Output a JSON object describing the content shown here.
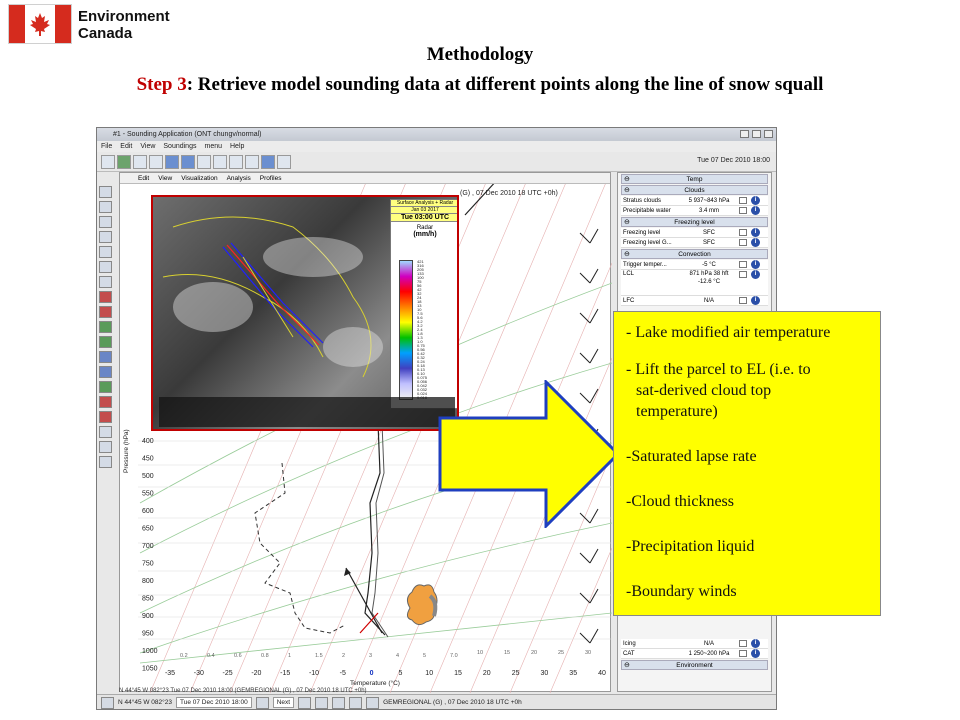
{
  "header": {
    "logo_text_line1": "Environment",
    "logo_text_line2": "Canada",
    "title": "Methodology",
    "subtitle_step": "Step 3",
    "subtitle_rest": ": Retrieve model sounding data at different points along the line of snow squall"
  },
  "app": {
    "window_title": "#1 - Sounding Application (ONT chungv/normal)",
    "menu": [
      "File",
      "Edit",
      "View",
      "Soundings",
      "menu",
      "Help"
    ],
    "datetime": "Tue 07 Dec 2010 18:00",
    "chart_menu": [
      "Edit",
      "View",
      "Visualization",
      "Analysis",
      "Profiles"
    ],
    "chart_header": "(G) , 07 Dec 2010 18 UTC +0h)",
    "pressure_axis_label": "Pressure (hPa)",
    "pressure_ticks": [
      "400",
      "450",
      "500",
      "550",
      "600",
      "650",
      "700",
      "750",
      "800",
      "850",
      "900",
      "950",
      "1000",
      "1050"
    ],
    "temperature_axis_label": "Temperature (°C)",
    "temperature_ticks": [
      "-35",
      "-30",
      "-25",
      "-20",
      "-15",
      "-10",
      "-5",
      "0",
      "5",
      "10",
      "15",
      "20",
      "25",
      "30",
      "35",
      "40"
    ],
    "mixing_ratio_ticks": [
      "0.2",
      "0.4",
      "0.6",
      "0.8",
      "1",
      "1.5",
      "2",
      "3",
      "4",
      "5",
      "7.0",
      "10",
      "15",
      "20",
      "25",
      "30"
    ],
    "status_line": "N 44°45 W 082°23  Tue 07 Dec 2010 18:00 (GEMREGIONAL (G) , 07 Dec 2010 18 UTC +0h)",
    "bottom": {
      "location": "N 44°45 W 082°23",
      "date": "Tue 07 Dec 2010 18:00",
      "next": "Next",
      "model": "GEMREGIONAL (G) , 07 Dec 2010 18 UTC +0h"
    },
    "satellite": {
      "legend_top": "Surface Analysis + Radar",
      "legend_date": "Jan 03 2017",
      "legend_time": "Tue 03:00 UTC",
      "legend_product": "Radar",
      "legend_units": "(mm/h)",
      "scale_values": [
        "421",
        "316",
        "205",
        "133",
        "100",
        "75",
        "56",
        "42",
        "32",
        "24",
        "18",
        "13",
        "10",
        "7.5",
        "5.6",
        "4.2",
        "3.2",
        "2.4",
        "1.8",
        "1.3",
        "1.0",
        "0.75",
        "0.56",
        "0.42",
        "0.32",
        "0.24",
        "0.18",
        "0.13",
        "0.10",
        "0.075",
        "0.056",
        "0.042",
        "0.032",
        "0.024",
        "0.018"
      ]
    },
    "side_panel": {
      "temp_header": "Temp",
      "clouds_header": "Clouds",
      "clouds_rows": [
        {
          "k": "Stratus clouds",
          "v": "5  937~843 hPa"
        },
        {
          "k": "Precipitable water",
          "v": "3.4 mm"
        }
      ],
      "freezing_header": "Freezing level",
      "freezing_rows": [
        {
          "k": "Freezing level",
          "v": "SFC"
        },
        {
          "k": "Freezing level G...",
          "v": "SFC"
        }
      ],
      "convection_header": "Convection",
      "convection_rows": [
        {
          "k": "Trigger temper...",
          "v": "-5 °C"
        },
        {
          "k": "LCL",
          "v": "871 hPa 38 hft -12.6 °C"
        },
        {
          "k": "LFC",
          "v": "N/A"
        }
      ],
      "bottom_rows": [
        {
          "k": "Icing",
          "v": "N/A"
        },
        {
          "k": "CAT",
          "v": "1  250~200 hPa"
        }
      ],
      "environment_header": "Environment"
    }
  },
  "note": {
    "lines": [
      "- Lake modified air temperature",
      "- Lift the parcel to EL (i.e. to",
      "sat-derived cloud top",
      "temperature)",
      "-Saturated lapse rate",
      "-Cloud thickness",
      "-Precipitation liquid",
      "-Boundary winds"
    ]
  },
  "colors": {
    "title_red": "#c00000",
    "note_bg": "#ffff00",
    "arrow_fill": "#ffff00",
    "arrow_stroke": "#1f3fbf"
  }
}
